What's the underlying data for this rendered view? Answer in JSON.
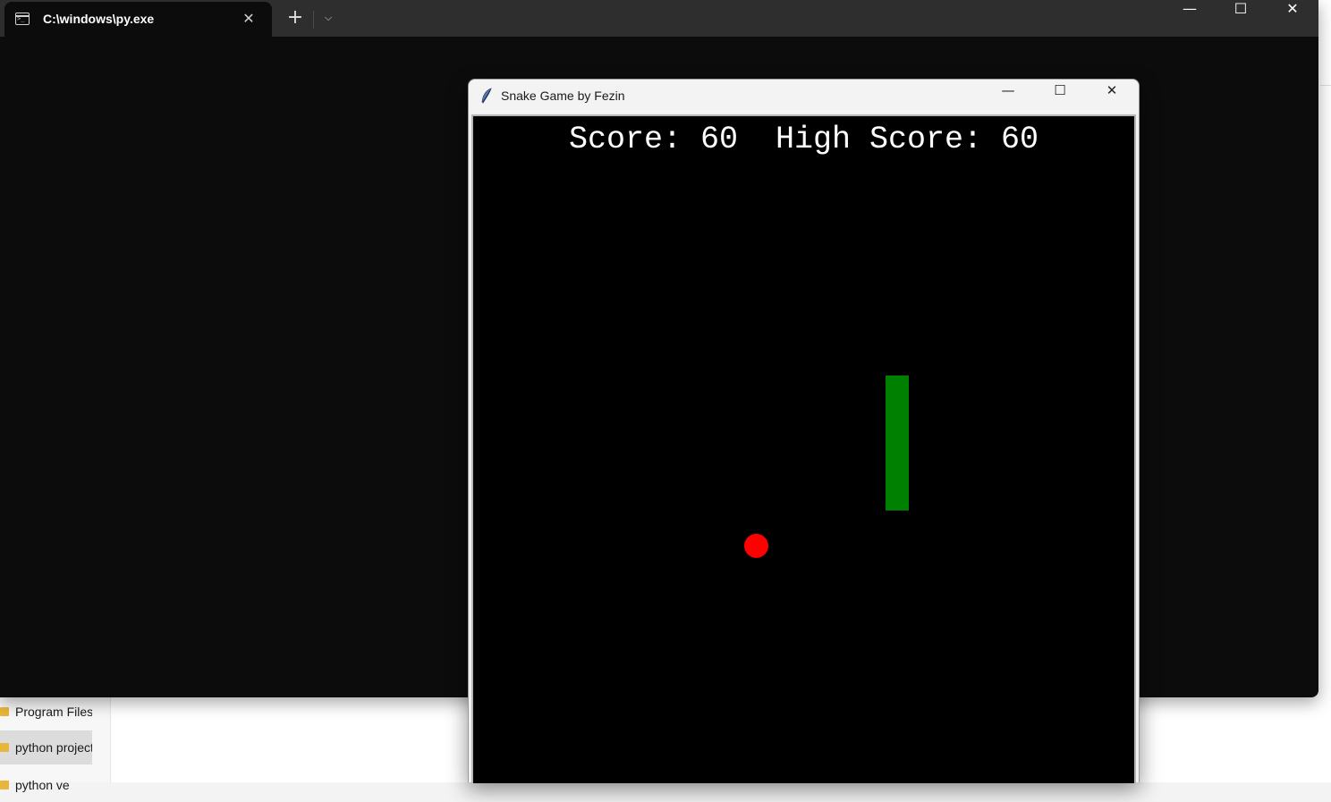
{
  "terminal": {
    "tab_title": "C:\\windows\\py.exe",
    "tab_close_glyph": "✕",
    "new_tab_glyph": "+",
    "dropdown_glyph": "⌵",
    "minimize_glyph": "—",
    "maximize_glyph": "☐",
    "close_glyph": "✕"
  },
  "explorer": {
    "nav_items": [
      {
        "label": "Program Files",
        "selected": false
      },
      {
        "label": "python projects",
        "selected": true
      },
      {
        "label": "python ve",
        "selected": false
      }
    ]
  },
  "snake_window": {
    "title": "Snake Game by Fezin",
    "minimize_glyph": "—",
    "maximize_glyph": "☐",
    "close_glyph": "✕",
    "score_line": "Score: 60  High Score: 60",
    "score": 60,
    "high_score": 60
  },
  "colors": {
    "snake": "#008000",
    "food": "#ff0000",
    "canvas_bg": "#000000",
    "score_text": "#ffffff"
  }
}
